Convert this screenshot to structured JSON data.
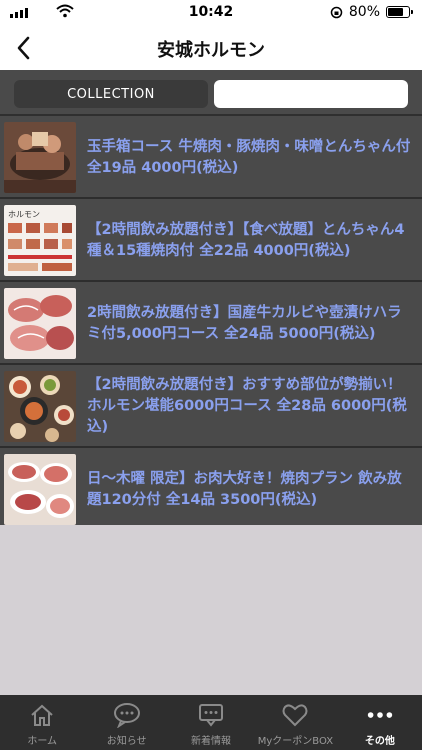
{
  "status_bar": {
    "time": "10:42",
    "battery": "80%",
    "battery_level": 0.8
  },
  "nav": {
    "title": "安城ホルモン"
  },
  "segments": {
    "collection": "COLLECTION",
    "other": ""
  },
  "items": [
    {
      "title": "玉手箱コース 牛焼肉・豚焼肉・味噌とんちゃん付 全19品 4000円(税込)",
      "thumb": "grill-platter"
    },
    {
      "title": "【2時間飲み放題付き】【食べ放題】とんちゃん4種＆15種焼肉付 全22品 4000円(税込)",
      "thumb": "menu-sheet"
    },
    {
      "title": "2時間飲み放題付き】国産牛カルビや壺漬けハラミ付5,000円コース 全24品 5000円(税込)",
      "thumb": "meat-plate"
    },
    {
      "title": "【2時間飲み放題付き】おすすめ部位が勢揃い！ホルモン堪能6000円コース 全28品 6000円(税込)",
      "thumb": "course-spread"
    },
    {
      "title": "日～木曜 限定】お肉大好き！焼肉プラン 飲み放題120分付 全14品 3500円(税込)",
      "thumb": "yakiniku-plan"
    }
  ],
  "tabs": [
    {
      "label": "ホーム",
      "icon": "home-icon"
    },
    {
      "label": "お知らせ",
      "icon": "chat-bubble-icon"
    },
    {
      "label": "新着情報",
      "icon": "message-icon"
    },
    {
      "label": "MyクーポンBOX",
      "icon": "heart-icon"
    },
    {
      "label": "その他",
      "icon": "more-dots-icon"
    }
  ]
}
